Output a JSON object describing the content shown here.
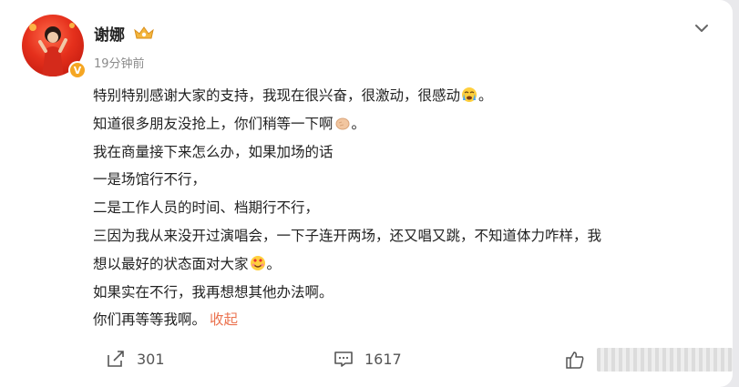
{
  "post": {
    "author": "谢娜",
    "time": "19分钟前",
    "lines": {
      "l1": "特别特别感谢大家的支持，我现在很兴奋，很激动，很感动",
      "l1b": "。",
      "l2": "知道很多朋友没抢上，你们稍等一下啊",
      "l2b": "。",
      "l3": "我在商量接下来怎么办，如果加场的话",
      "l4": "一是场馆行不行，",
      "l5": "二是工作人员的时间、档期行不行，",
      "l6": "三因为我从来没开过演唱会，一下子连开两场，还又唱又跳，不知道体力咋样，我",
      "l7": "想以最好的状态面对大家",
      "l7b": "。",
      "l8": "如果实在不行，我再想想其他办法啊。",
      "l9": "你们再等等我啊。"
    },
    "collapse_label": "收起"
  },
  "footer": {
    "repost_count": "301",
    "comment_count": "1617"
  },
  "colors": {
    "accent": "#eb7350",
    "verified": "#f5a623"
  },
  "icons": [
    "more-chevron-icon",
    "repost-icon",
    "comment-icon",
    "like-icon",
    "crying-emoji-icon",
    "palm-emoji-icon",
    "love-emoji-icon",
    "vip-crown-badge-icon"
  ]
}
